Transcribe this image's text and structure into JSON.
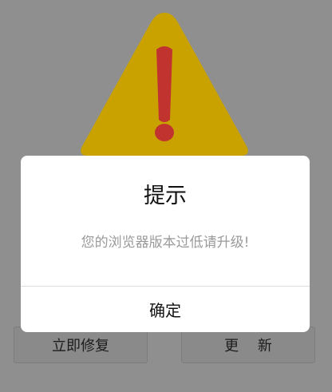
{
  "dialog": {
    "title": "提示",
    "message": "您的浏览器版本过低请升级!",
    "confirm_label": "确定"
  },
  "background": {
    "repair_button_label": "立即修复",
    "update_button_label": "更 新",
    "warning_icon": "warning-triangle-icon"
  },
  "colors": {
    "overlay": "#8f8f8f",
    "warning_triangle": "#c9a200",
    "exclamation": "#c1332f",
    "dialog_bg": "#ffffff"
  }
}
